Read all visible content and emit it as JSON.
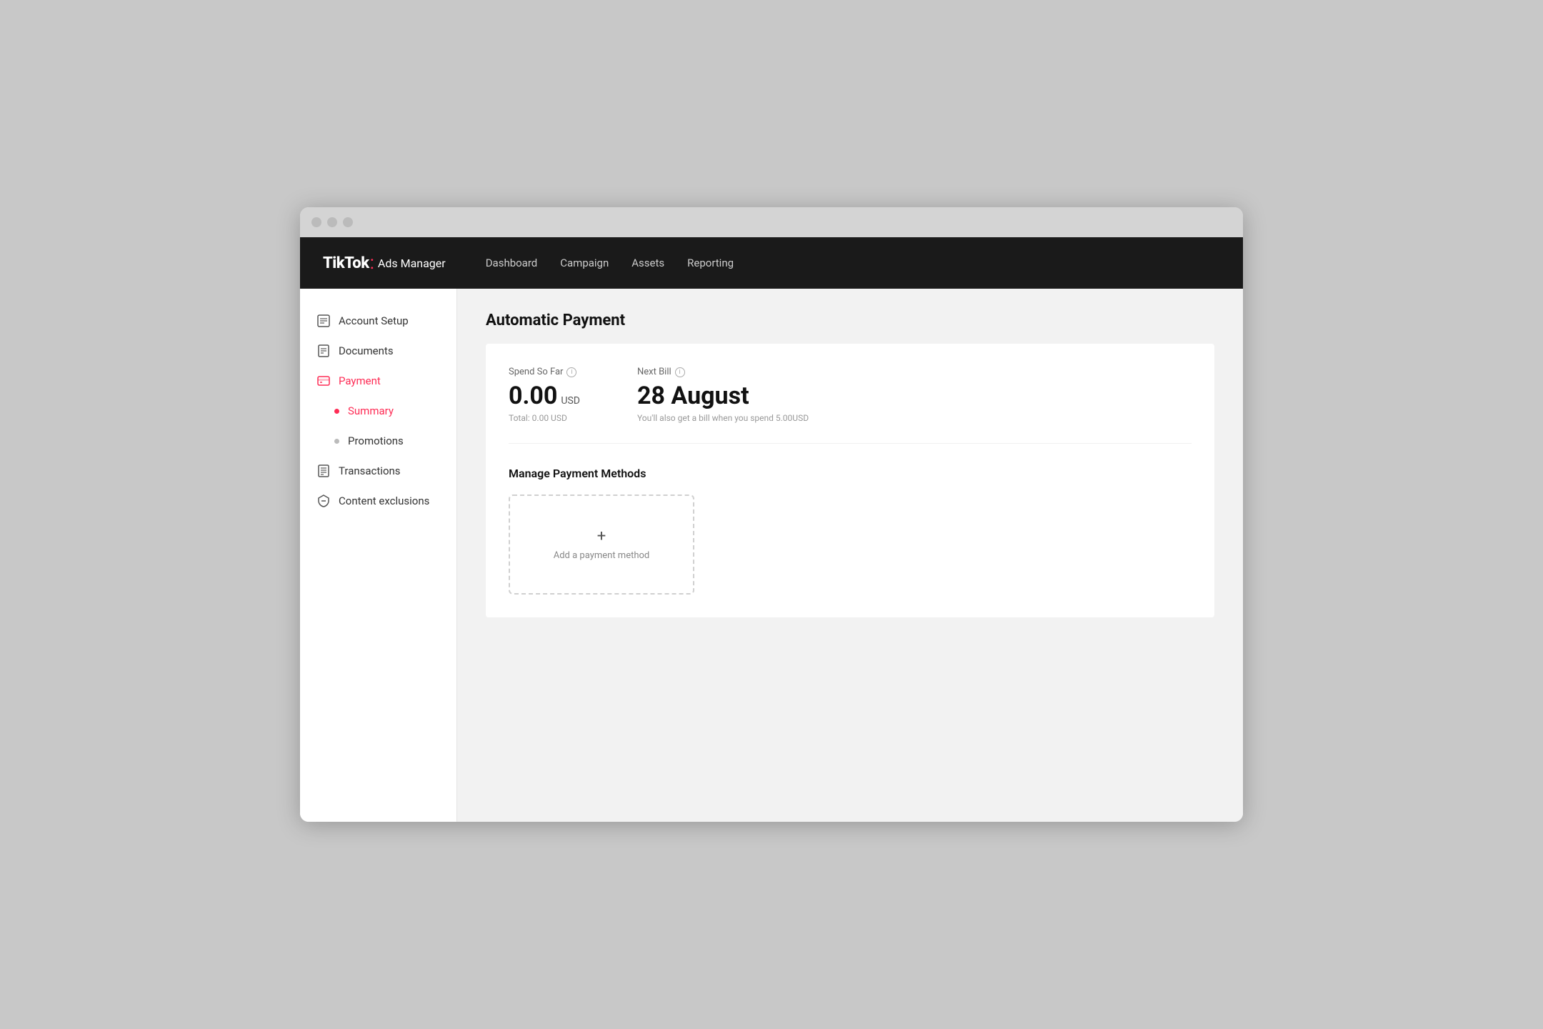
{
  "browser": {
    "traffic_lights": [
      "close",
      "minimize",
      "maximize"
    ]
  },
  "topnav": {
    "logo": "TikTok",
    "logo_dot": ":",
    "logo_subtitle": "Ads Manager",
    "nav_items": [
      {
        "label": "Dashboard",
        "active": false
      },
      {
        "label": "Campaign",
        "active": false
      },
      {
        "label": "Assets",
        "active": false
      },
      {
        "label": "Reporting",
        "active": true
      }
    ]
  },
  "sidebar": {
    "items": [
      {
        "id": "account-setup",
        "label": "Account Setup",
        "type": "icon-item",
        "active": false
      },
      {
        "id": "documents",
        "label": "Documents",
        "type": "icon-item",
        "active": false
      },
      {
        "id": "payment",
        "label": "Payment",
        "type": "icon-item",
        "active": true
      },
      {
        "id": "summary",
        "label": "Summary",
        "type": "sub-item",
        "active": true
      },
      {
        "id": "promotions",
        "label": "Promotions",
        "type": "sub-item",
        "active": false
      },
      {
        "id": "transactions",
        "label": "Transactions",
        "type": "icon-item",
        "active": false
      },
      {
        "id": "content-exclusions",
        "label": "Content exclusions",
        "type": "icon-item",
        "active": false
      }
    ]
  },
  "main": {
    "page_title": "Automatic Payment",
    "spend_so_far_label": "Spend So Far",
    "spend_amount": "0.00",
    "spend_currency": "USD",
    "spend_total": "Total: 0.00 USD",
    "next_bill_label": "Next Bill",
    "next_bill_date": "28 August",
    "next_bill_note": "You'll also get a bill when you spend 5.00USD",
    "manage_payment_methods_title": "Manage Payment Methods",
    "add_payment_label": "Add a payment method"
  }
}
